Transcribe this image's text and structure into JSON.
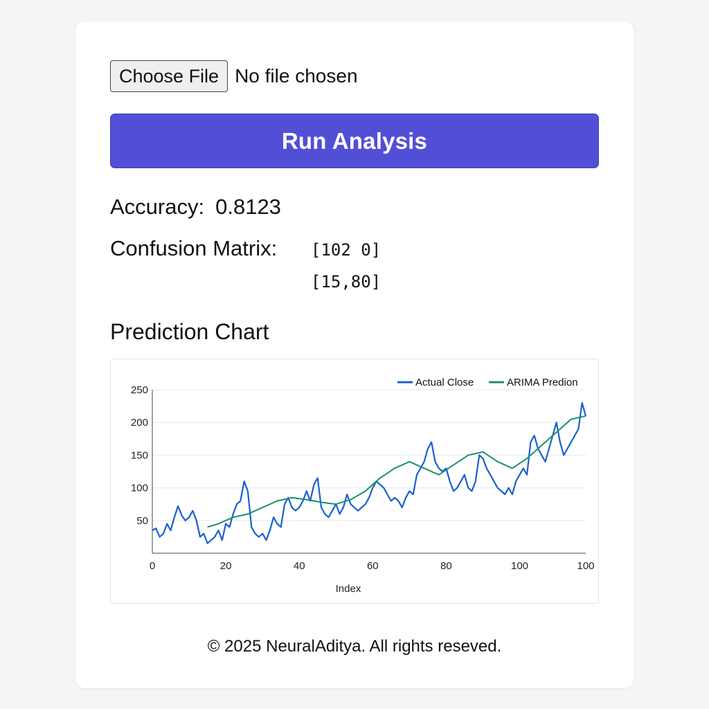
{
  "upload": {
    "button_label": "Choose File",
    "status_text": "No file chosen"
  },
  "run_button": {
    "label": "Run Analysis",
    "color": "#524fd6"
  },
  "results": {
    "accuracy_label": "Accuracy:",
    "accuracy_value": "0.8123",
    "confusion_label": "Confusion Matrix:",
    "confusion_rows": [
      "[102 0]",
      "[15,80]"
    ]
  },
  "chart_title": "Prediction Chart",
  "chart_data": {
    "type": "line",
    "xlabel": "Index",
    "ylabel": "",
    "xlim": [
      0,
      118
    ],
    "ylim": [
      0,
      250
    ],
    "x_ticks": [
      0,
      20,
      40,
      60,
      80,
      100
    ],
    "x_tick_labels": [
      "0",
      "20",
      "40",
      "60",
      "80",
      "100",
      "100"
    ],
    "y_ticks": [
      50,
      100,
      150,
      200,
      250
    ],
    "y_tick_labels": [
      "50",
      "100",
      "150",
      "200",
      "250"
    ],
    "grid": "horizontal",
    "legend_position": "top-right",
    "series": [
      {
        "name": "Actual Close",
        "color": "#1a5fd0",
        "x": [
          0,
          1,
          2,
          3,
          4,
          5,
          6,
          7,
          8,
          9,
          10,
          11,
          12,
          13,
          14,
          15,
          16,
          17,
          18,
          19,
          20,
          21,
          22,
          23,
          24,
          25,
          26,
          27,
          28,
          29,
          30,
          31,
          32,
          33,
          34,
          35,
          36,
          37,
          38,
          39,
          40,
          41,
          42,
          43,
          44,
          45,
          46,
          47,
          48,
          49,
          50,
          51,
          52,
          53,
          54,
          55,
          56,
          57,
          58,
          59,
          60,
          61,
          62,
          63,
          64,
          65,
          66,
          67,
          68,
          69,
          70,
          71,
          72,
          73,
          74,
          75,
          76,
          77,
          78,
          79,
          80,
          81,
          82,
          83,
          84,
          85,
          86,
          87,
          88,
          89,
          90,
          91,
          92,
          93,
          94,
          95,
          96,
          97,
          98,
          99,
          100,
          101,
          102,
          103,
          104,
          105,
          106,
          107,
          108,
          109,
          110,
          111,
          112,
          113,
          114,
          115,
          116,
          117,
          118
        ],
        "values": [
          35,
          38,
          25,
          30,
          45,
          35,
          55,
          72,
          58,
          50,
          55,
          65,
          50,
          25,
          30,
          15,
          20,
          25,
          35,
          20,
          45,
          40,
          60,
          75,
          80,
          110,
          95,
          40,
          30,
          25,
          30,
          20,
          35,
          55,
          45,
          40,
          75,
          85,
          70,
          65,
          70,
          80,
          95,
          80,
          105,
          115,
          70,
          60,
          55,
          65,
          75,
          60,
          70,
          90,
          75,
          70,
          65,
          70,
          75,
          85,
          100,
          110,
          105,
          100,
          90,
          80,
          85,
          80,
          70,
          85,
          95,
          90,
          120,
          130,
          140,
          160,
          170,
          140,
          130,
          125,
          130,
          110,
          95,
          100,
          110,
          120,
          100,
          95,
          110,
          150,
          145,
          130,
          120,
          110,
          100,
          95,
          90,
          100,
          90,
          110,
          120,
          130,
          120,
          170,
          180,
          160,
          150,
          140,
          160,
          180,
          200,
          170,
          150,
          160,
          170,
          180,
          190,
          230,
          210
        ]
      },
      {
        "name": "ARIMA Predion",
        "color": "#1d8f6a",
        "x": [
          15,
          18,
          22,
          26,
          30,
          34,
          38,
          42,
          46,
          50,
          54,
          58,
          62,
          66,
          70,
          74,
          78,
          82,
          86,
          90,
          94,
          98,
          102,
          106,
          110,
          114,
          118
        ],
        "values": [
          40,
          45,
          55,
          60,
          70,
          80,
          85,
          82,
          78,
          75,
          82,
          95,
          115,
          130,
          140,
          130,
          120,
          135,
          150,
          155,
          140,
          130,
          145,
          165,
          185,
          205,
          210
        ]
      }
    ]
  },
  "footer": {
    "text": "© 2025 NeuralAditya. All rights reseved."
  }
}
